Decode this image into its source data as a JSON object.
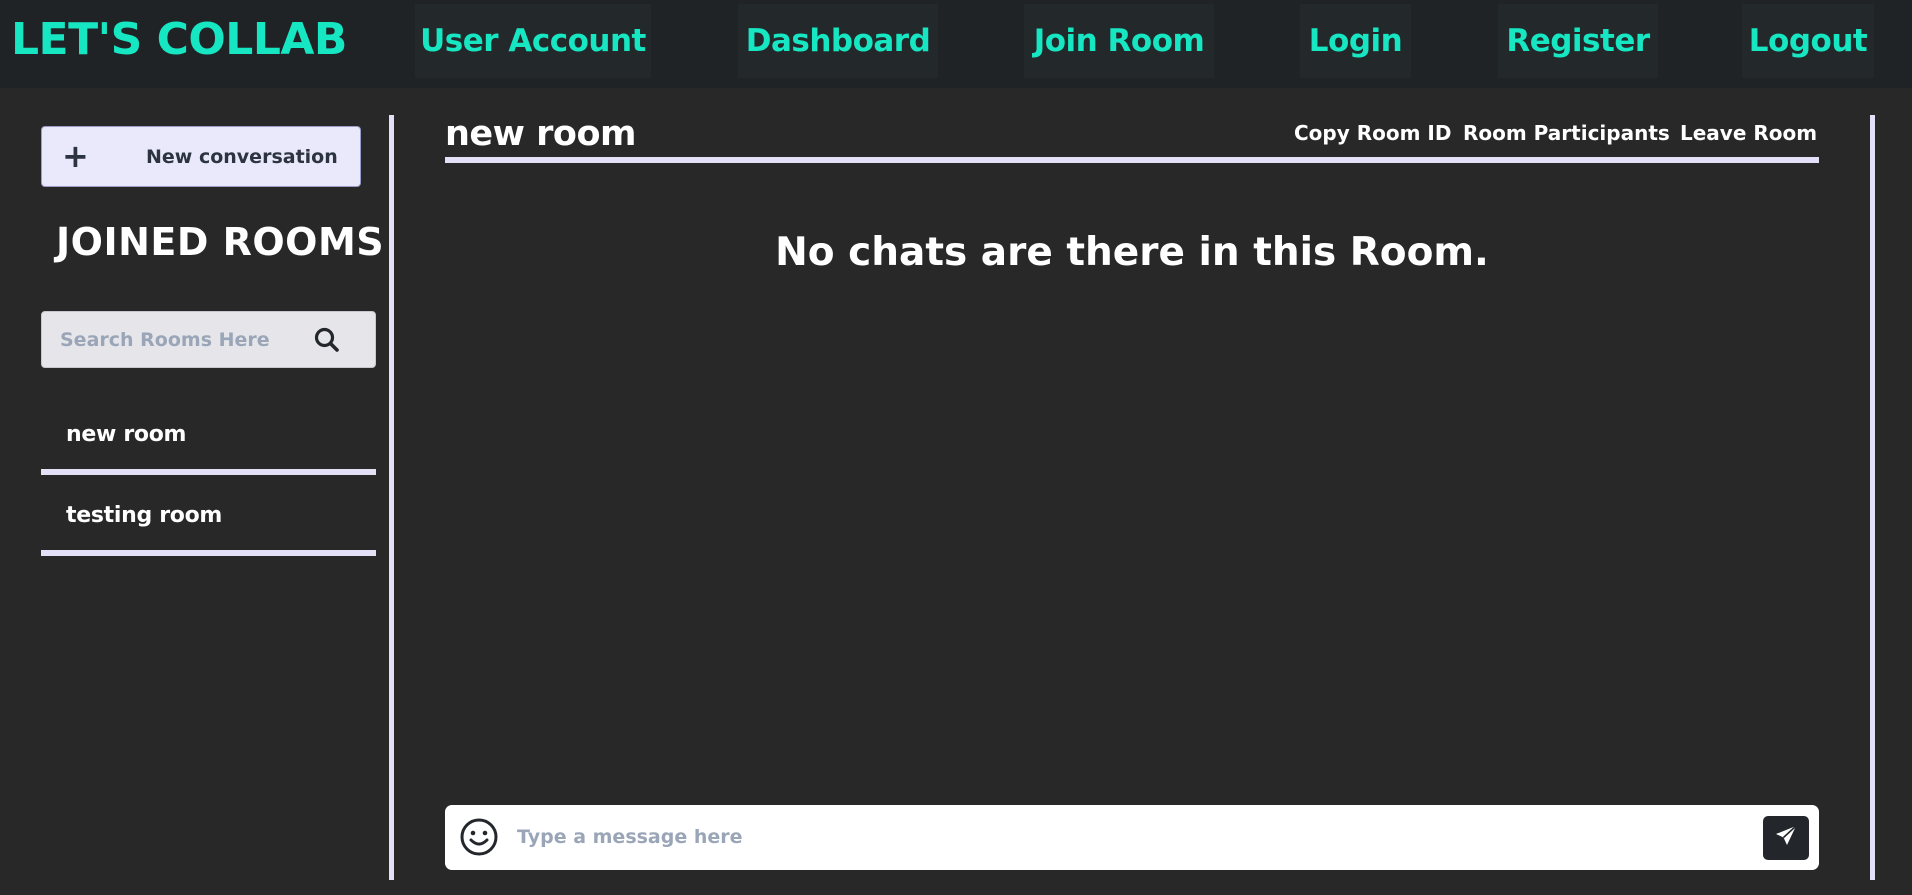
{
  "navbar": {
    "brand": "LET'S COLLAB",
    "links": [
      {
        "label": "User Account"
      },
      {
        "label": "Dashboard"
      },
      {
        "label": "Join Room"
      },
      {
        "label": "Login"
      },
      {
        "label": "Register"
      },
      {
        "label": "Logout"
      }
    ]
  },
  "sidebar": {
    "new_conversation_icon": "plus-icon",
    "new_conversation_label": "New conversation",
    "title": "JOINED ROOMS",
    "search": {
      "placeholder": "Search Rooms Here",
      "value": "",
      "icon": "search-icon"
    },
    "rooms": [
      {
        "name": "new room"
      },
      {
        "name": "testing room"
      }
    ]
  },
  "chat": {
    "room_name": "new room",
    "actions": [
      {
        "label": "Copy Room ID"
      },
      {
        "label": "Room Participants"
      },
      {
        "label": "Leave Room"
      }
    ],
    "empty_message": "No chats are there in this Room.",
    "composer": {
      "placeholder": "Type a message here",
      "value": "",
      "emoji_icon": "smiley-icon",
      "send_icon": "paper-plane-icon"
    }
  },
  "colors": {
    "accent": "#17e6c2",
    "background": "#282828",
    "navbar_bg": "#1f2326",
    "divider": "#e4e0f7",
    "send_button": "#23272b"
  }
}
